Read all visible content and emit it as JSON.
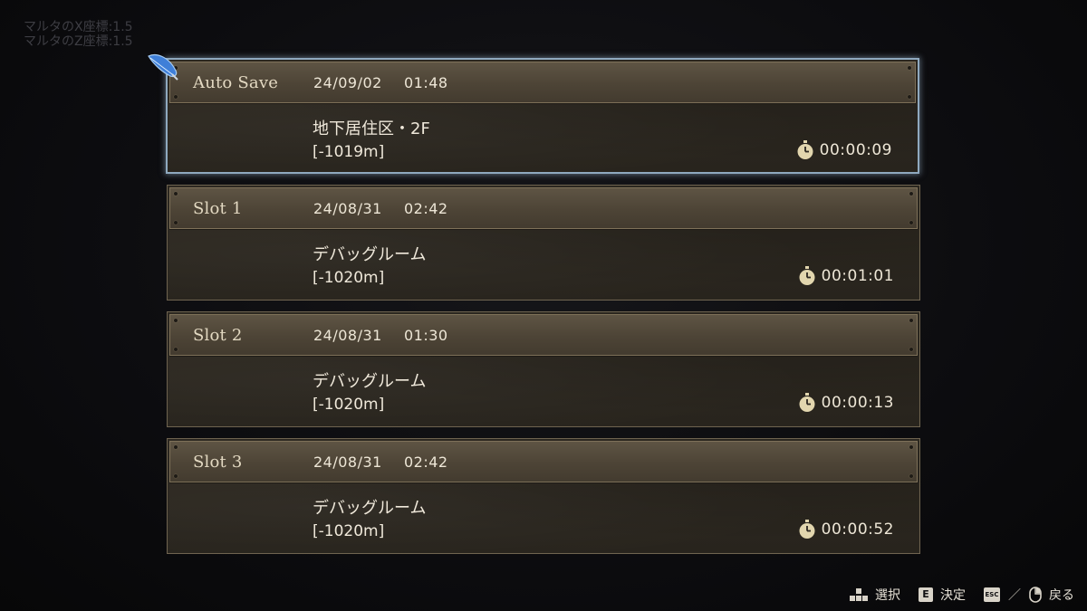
{
  "debug": {
    "line1": "マルタのX座標:1.5",
    "line2": "マルタのZ座標:1.5"
  },
  "slots": [
    {
      "name": "Auto Save",
      "date": "24/09/02",
      "time": "01:48",
      "location": "地下居住区・2F",
      "depth": "[-1019m]",
      "playtime": "00:00:09",
      "selected": true
    },
    {
      "name": "Slot 1",
      "date": "24/08/31",
      "time": "02:42",
      "location": "デバッグルーム",
      "depth": "[-1020m]",
      "playtime": "00:01:01",
      "selected": false
    },
    {
      "name": "Slot 2",
      "date": "24/08/31",
      "time": "01:30",
      "location": "デバッグルーム",
      "depth": "[-1020m]",
      "playtime": "00:00:13",
      "selected": false
    },
    {
      "name": "Slot 3",
      "date": "24/08/31",
      "time": "02:42",
      "location": "デバッグルーム",
      "depth": "[-1020m]",
      "playtime": "00:00:52",
      "selected": false
    }
  ],
  "controls": {
    "select_label": "選択",
    "confirm_key": "E",
    "confirm_label": "決定",
    "back_key": "ESC",
    "back_label": "戻る"
  },
  "colors": {
    "selection_border": "#8fa9bf",
    "header_bg": "#4d4436",
    "panel_bg": "#2b2620",
    "text": "#ede6d6",
    "feather": "#3f7fd8"
  },
  "icons": {
    "cursor": "feather-icon",
    "playtime": "stopwatch-icon",
    "select": "dpad-icon",
    "back": "mouse-icon"
  }
}
